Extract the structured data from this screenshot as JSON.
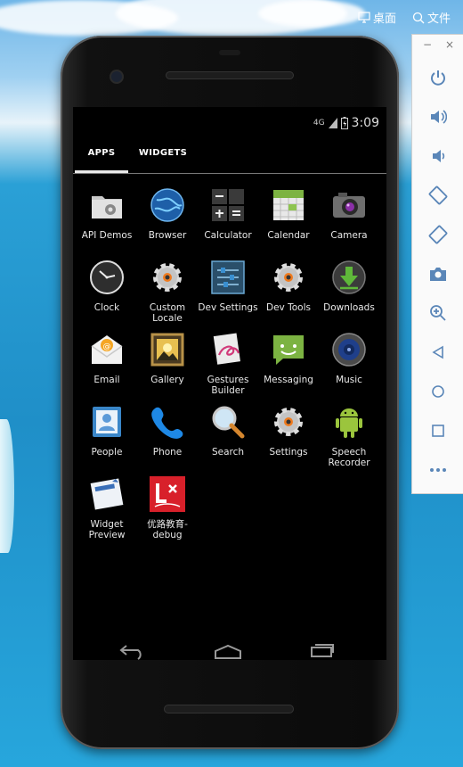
{
  "desktop": {
    "btn_desktop": "桌面",
    "btn_file": "文件"
  },
  "status": {
    "network": "4G",
    "time": "3:09"
  },
  "tabs": [
    {
      "label": "APPS"
    },
    {
      "label": "WIDGETS"
    }
  ],
  "apps": [
    {
      "label": "API Demos",
      "icon": "folder-gear-icon"
    },
    {
      "label": "Browser",
      "icon": "globe-icon"
    },
    {
      "label": "Calculator",
      "icon": "calculator-icon"
    },
    {
      "label": "Calendar",
      "icon": "calendar-icon"
    },
    {
      "label": "Camera",
      "icon": "camera-icon"
    },
    {
      "label": "Clock",
      "icon": "clock-icon"
    },
    {
      "label": "Custom\nLocale",
      "icon": "gear-icon"
    },
    {
      "label": "Dev Settings",
      "icon": "sliders-icon"
    },
    {
      "label": "Dev Tools",
      "icon": "gear-icon"
    },
    {
      "label": "Downloads",
      "icon": "download-icon"
    },
    {
      "label": "Email",
      "icon": "email-icon"
    },
    {
      "label": "Gallery",
      "icon": "gallery-icon"
    },
    {
      "label": "Gestures\nBuilder",
      "icon": "gestures-icon"
    },
    {
      "label": "Messaging",
      "icon": "messaging-icon"
    },
    {
      "label": "Music",
      "icon": "speaker-icon"
    },
    {
      "label": "People",
      "icon": "contacts-icon"
    },
    {
      "label": "Phone",
      "icon": "phone-icon"
    },
    {
      "label": "Search",
      "icon": "magnifier-icon"
    },
    {
      "label": "Settings",
      "icon": "gear-icon"
    },
    {
      "label": "Speech\nRecorder",
      "icon": "android-icon"
    },
    {
      "label": "Widget\nPreview",
      "icon": "widget-preview-icon"
    },
    {
      "label": "优路教育-\ndebug",
      "icon": "youlu-logo-icon"
    }
  ],
  "side_panel": {
    "minimize": "−",
    "close": "×"
  },
  "colors": {
    "accent_red": "#d8202a",
    "messaging_green": "#7cb342",
    "android_green": "#9bc53d"
  }
}
